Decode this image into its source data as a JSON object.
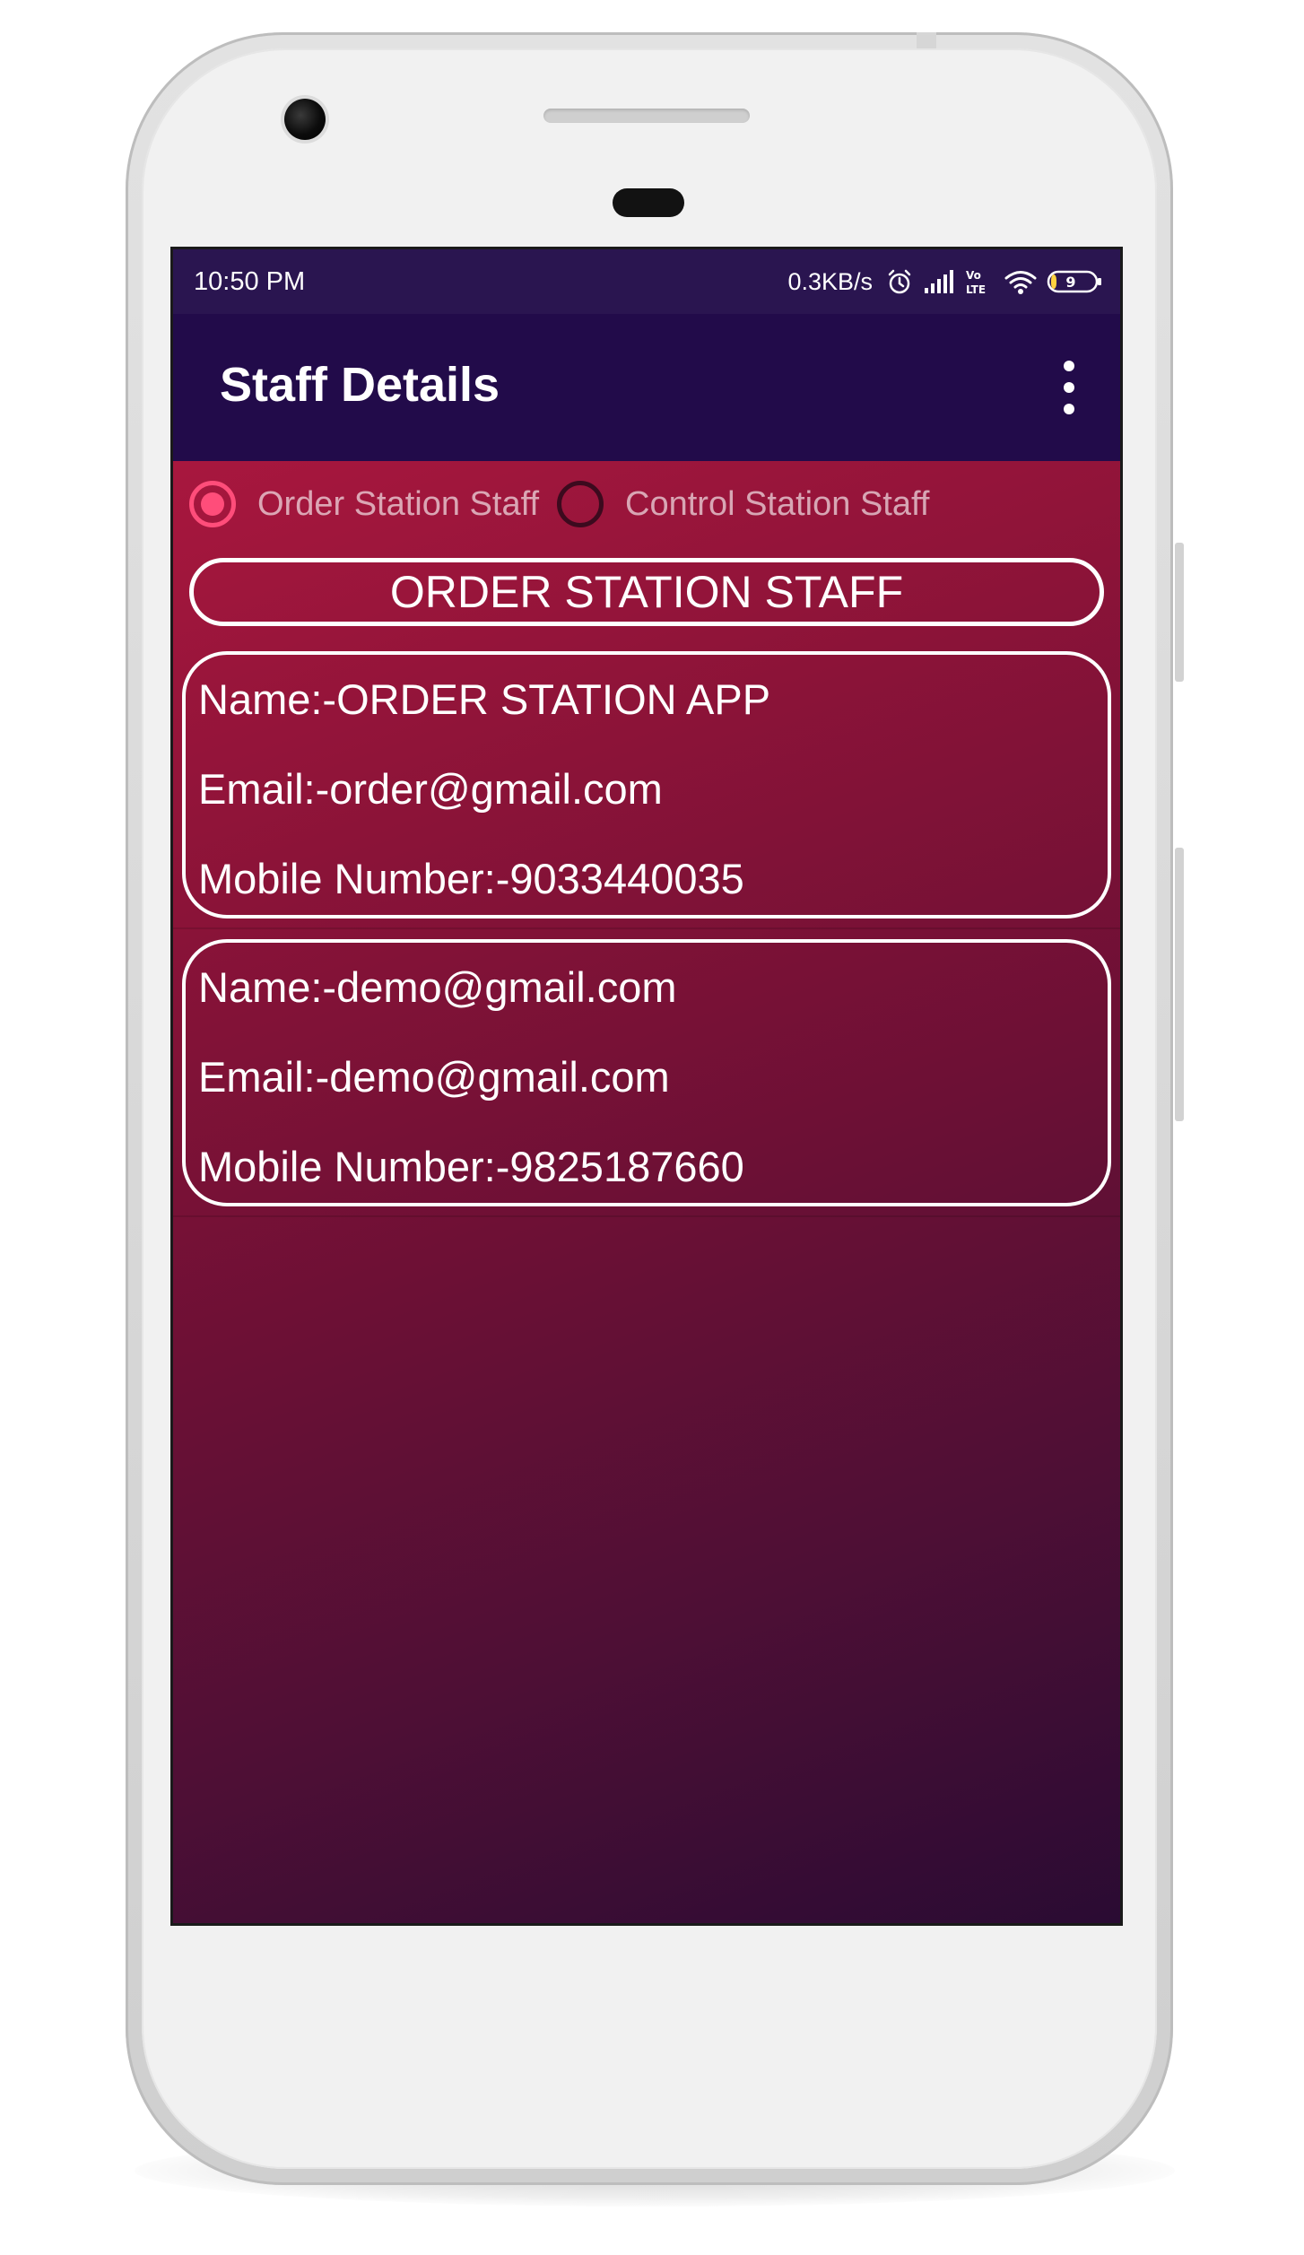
{
  "status_bar": {
    "time": "10:50 PM",
    "network_speed": "0.3KB/s",
    "battery_level": "9",
    "icons": [
      "alarm-icon",
      "signal-icon",
      "volte-lte-icon",
      "wifi-icon",
      "battery-icon"
    ]
  },
  "app_bar": {
    "title": "Staff Details",
    "menu_icon": "overflow-menu-icon"
  },
  "staff_type_selector": {
    "options": [
      {
        "label": "Order Station Staff",
        "selected": true
      },
      {
        "label": "Control Station Staff",
        "selected": false
      }
    ]
  },
  "section_header": {
    "label": "ORDER STATION STAFF"
  },
  "staff_list": [
    {
      "name": "Name:-ORDER STATION APP",
      "email": "Email:-order@gmail.com",
      "mobile": "Mobile Number:-9033440035"
    },
    {
      "name": "Name:-demo@gmail.com",
      "email": "Email:-demo@gmail.com",
      "mobile": "Mobile Number:-9825187660"
    }
  ],
  "colors": {
    "status_bar": "#2a1550",
    "app_bar": "#220b4a",
    "gradient_top": "#a8173e",
    "gradient_bottom": "#2a0b33",
    "radio_accent": "#ff4d7a"
  }
}
